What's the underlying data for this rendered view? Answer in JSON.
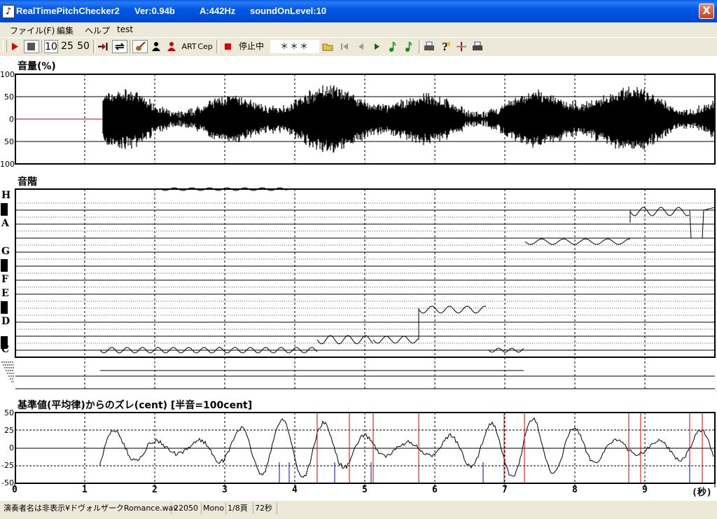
{
  "window": {
    "app_name": "RealTimePitchChecker2",
    "version": "Ver:0.94b",
    "a_hz": "A:442Hz",
    "sound_level": "soundOnLevel:10",
    "close_glyph": "X"
  },
  "menu": [
    "ファイル(F)",
    "編集",
    "ヘルプ",
    "test"
  ],
  "toolbar": {
    "zoom10": "10",
    "zoom25": "25",
    "zoom50": "50",
    "art": "ART",
    "cep": "Cep",
    "status": "停止中",
    "note_display": "＊＊＊",
    "icons": [
      "play-icon",
      "stop-icon",
      "jump-end-icon",
      "loop-icon",
      "violin-icon",
      "person-black-icon",
      "person-red-icon",
      "record-icon",
      "open-folder-icon",
      "first-icon",
      "prev-icon",
      "next-icon",
      "note-icon",
      "note-alt-icon",
      "print-icon",
      "help-icon",
      "cross-icon",
      "printer-icon"
    ]
  },
  "volume_panel": {
    "title": "音量(%)",
    "y_labels": [
      "100",
      "50",
      "0",
      "50",
      "100"
    ]
  },
  "scale_panel": {
    "title": "音階",
    "notes": [
      "H",
      "A",
      "G",
      "F",
      "E",
      "D",
      "C"
    ]
  },
  "deviation_panel": {
    "title": "基準値(平均律)からのズレ(cent) [半音=100cent]",
    "y_labels": [
      "50",
      "25",
      "0",
      "-25",
      "-50"
    ]
  },
  "x_axis": {
    "labels": [
      "0",
      "1",
      "2",
      "3",
      "4",
      "5",
      "6",
      "7",
      "8",
      "9"
    ],
    "unit": "(秒)"
  },
  "statusbar": {
    "file": "演奏者名は非表示¥ドヴォルザークRomance.wav",
    "rate": "22050",
    "channel": "Mono",
    "page": "1/8頁",
    "duration": "72秒"
  },
  "colors": {
    "titlebar": "#0058E6",
    "waveform": "#000000",
    "zero_line": "#CC0000",
    "marker_red": "#E00000",
    "marker_blue": "#0000CC"
  }
}
